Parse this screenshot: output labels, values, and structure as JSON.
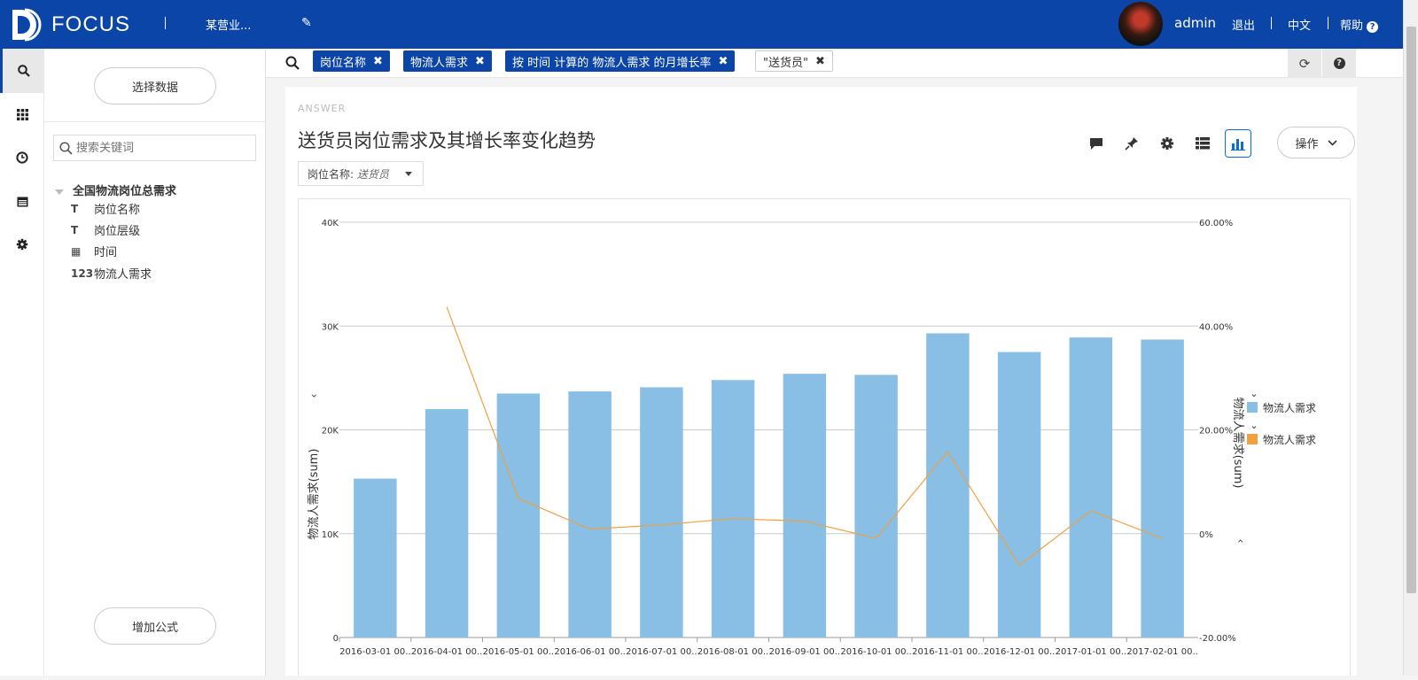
{
  "topbar": {
    "logo_text": "FOCUS",
    "project": "某营业...",
    "user": "admin",
    "logout": "退出",
    "lang": "中文",
    "help": "帮助"
  },
  "sidebar": {
    "icons": [
      "search-icon",
      "apps-icon",
      "clock-icon",
      "calendar-icon",
      "gear-icon"
    ]
  },
  "panel": {
    "select_data": "选择数据",
    "search_placeholder": "搜索关键词",
    "tree_root": "全国物流岗位总需求",
    "fields": [
      {
        "type_label": "T",
        "name": "岗位名称"
      },
      {
        "type_label": "T",
        "name": "岗位层级"
      },
      {
        "type_label": "▦",
        "name": "时间"
      },
      {
        "type_label": "123",
        "name": "物流人需求"
      }
    ],
    "add_formula": "增加公式"
  },
  "searchbar": {
    "chips": [
      "岗位名称",
      "物流人需求",
      "按 时间 计算的 物流人需求 的月增长率"
    ],
    "value_chip": "\"送货员\""
  },
  "answer": {
    "label": "ANSWER",
    "title": "送货员岗位需求及其增长率变化趋势",
    "filter_label": "岗位名称:",
    "filter_value": "送货员",
    "operate": "操作"
  },
  "chart_data": {
    "type": "bar",
    "categories": [
      "2016-03-01 00..",
      "2016-04-01 00..",
      "2016-05-01 00..",
      "2016-06-01 00..",
      "2016-07-01 00..",
      "2016-08-01 00..",
      "2016-09-01 00..",
      "2016-10-01 00..",
      "2016-11-01 00..",
      "2016-12-01 00..",
      "2017-01-01 00..",
      "2017-02-01 00.."
    ],
    "series": [
      {
        "name": "物流人需求",
        "type": "bar",
        "axis": "left",
        "color": "#89bfe4",
        "values": [
          15300,
          22000,
          23500,
          23700,
          24100,
          24800,
          25400,
          25300,
          29300,
          27500,
          28900,
          28700
        ]
      },
      {
        "name": "物流人需求",
        "type": "line",
        "axis": "right",
        "color": "#f0a040",
        "values": [
          null,
          43.7,
          6.8,
          0.9,
          1.7,
          2.9,
          2.4,
          -0.9,
          15.8,
          -6.1,
          4.4,
          -0.9
        ]
      }
    ],
    "ylabel": "物流人需求(sum)",
    "y2label": "物流人需求(sum)",
    "ylim": [
      0,
      40000
    ],
    "y2lim": [
      -20,
      60
    ],
    "yticks": [
      "0",
      "10K",
      "20K",
      "30K",
      "40K"
    ],
    "y2ticks": [
      "-20.00%",
      "0%",
      "20.00%",
      "40.00%",
      "60.00%"
    ],
    "legend_position": "right",
    "grid": true
  }
}
